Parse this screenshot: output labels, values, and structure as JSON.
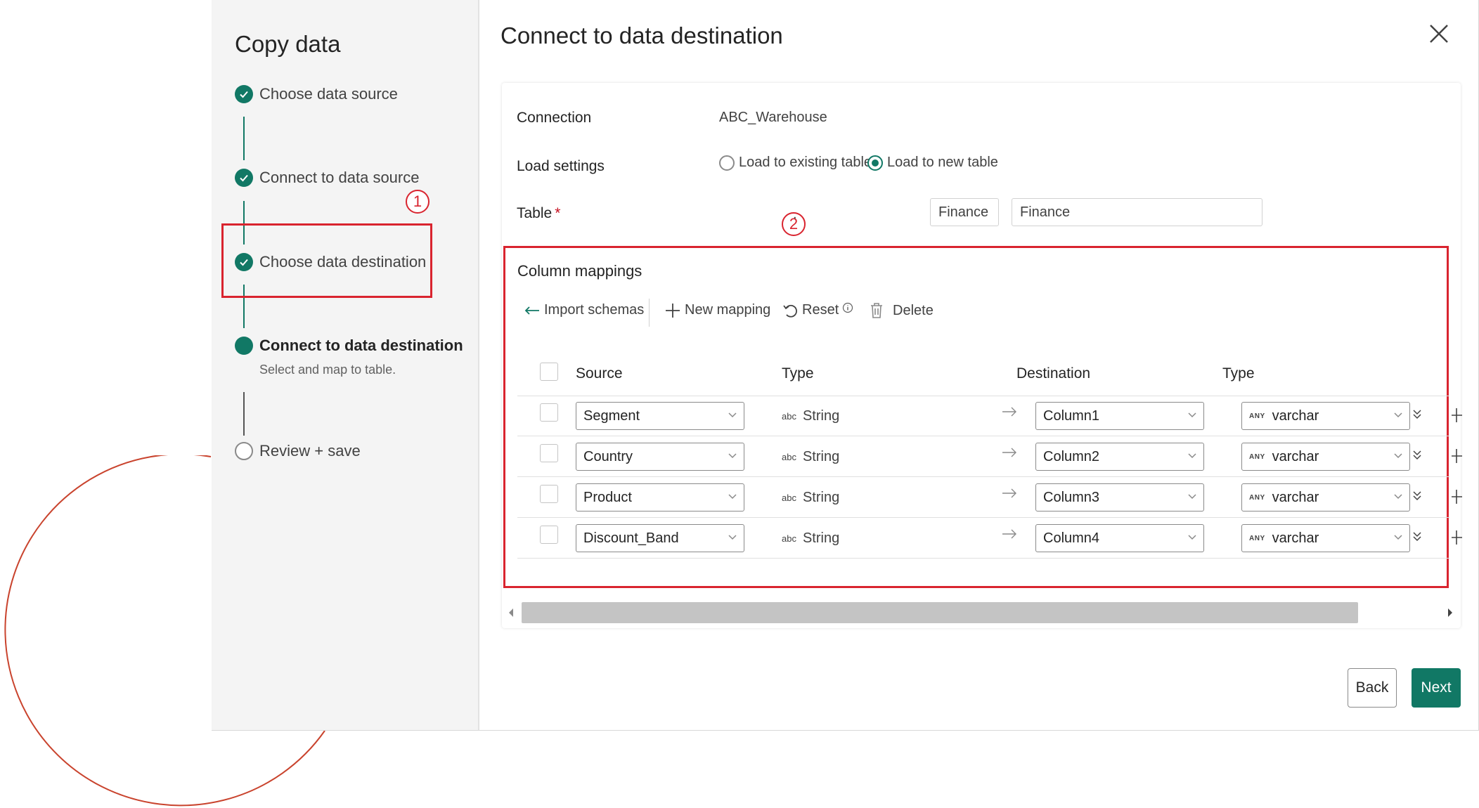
{
  "sidebar": {
    "title": "Copy data",
    "steps": [
      {
        "label": "Choose data source",
        "state": "done"
      },
      {
        "label": "Connect to data source",
        "state": "done"
      },
      {
        "label": "Choose data destination",
        "state": "done"
      },
      {
        "label": "Connect to data destination",
        "state": "current",
        "subtitle": "Select and map to table."
      },
      {
        "label": "Review + save",
        "state": "todo"
      }
    ]
  },
  "callouts": [
    "1",
    "2"
  ],
  "dialog": {
    "title": "Connect to data destination",
    "connection_label": "Connection",
    "connection_value": "ABC_Warehouse",
    "load_settings_label": "Load settings",
    "load_options": [
      {
        "label": "Load to existing table",
        "selected": false
      },
      {
        "label": "Load to new table",
        "selected": true
      }
    ],
    "table_label": "Table",
    "table_required_mark": "*",
    "table_schema": "Finance",
    "table_name": "Finance"
  },
  "mappings": {
    "title": "Column mappings",
    "toolbar": {
      "import_schemas": "Import schemas",
      "new_mapping": "New mapping",
      "reset": "Reset",
      "delete": "Delete"
    },
    "headers": {
      "source": "Source",
      "source_type": "Type",
      "destination": "Destination",
      "dest_type": "Type"
    },
    "rows": [
      {
        "source": "Segment",
        "source_type": "String",
        "destination": "Column1",
        "dest_type": "varchar"
      },
      {
        "source": "Country",
        "source_type": "String",
        "destination": "Column2",
        "dest_type": "varchar"
      },
      {
        "source": "Product",
        "source_type": "String",
        "destination": "Column3",
        "dest_type": "varchar"
      },
      {
        "source": "Discount_Band",
        "source_type": "String",
        "destination": "Column4",
        "dest_type": "varchar"
      }
    ],
    "type_prefix": "abc",
    "any_prefix": "ANY"
  },
  "footer": {
    "back": "Back",
    "next": "Next"
  },
  "colors": {
    "accent": "#117865",
    "highlight": "#d9242f"
  }
}
